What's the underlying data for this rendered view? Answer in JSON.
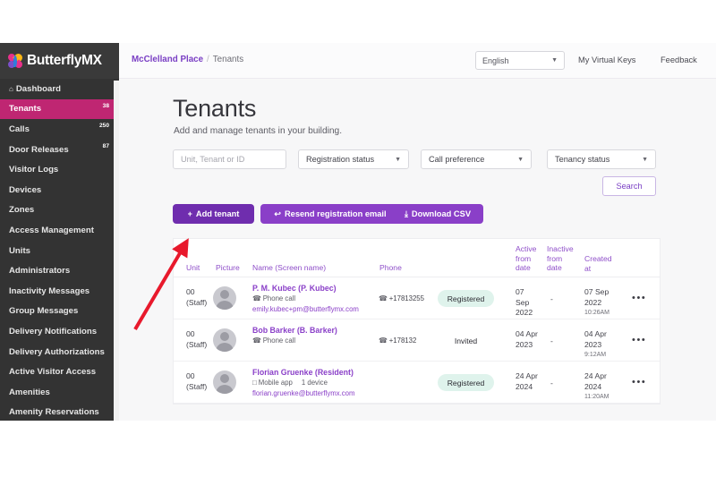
{
  "sidebar": {
    "logo_text": "ButterflyMX",
    "items": [
      {
        "label": "Dashboard",
        "badge": "",
        "active": false,
        "icon": "home-icon"
      },
      {
        "label": "Tenants",
        "badge": "38",
        "active": true,
        "icon": ""
      },
      {
        "label": "Calls",
        "badge": "250",
        "active": false,
        "icon": ""
      },
      {
        "label": "Door Releases",
        "badge": "87",
        "active": false,
        "icon": ""
      },
      {
        "label": "Visitor Logs",
        "badge": "",
        "active": false,
        "icon": ""
      },
      {
        "label": "Devices",
        "badge": "",
        "active": false,
        "icon": ""
      },
      {
        "label": "Zones",
        "badge": "",
        "active": false,
        "icon": ""
      },
      {
        "label": "Access Management",
        "badge": "",
        "active": false,
        "icon": ""
      },
      {
        "label": "Units",
        "badge": "",
        "active": false,
        "icon": ""
      },
      {
        "label": "Administrators",
        "badge": "",
        "active": false,
        "icon": ""
      },
      {
        "label": "Inactivity Messages",
        "badge": "",
        "active": false,
        "icon": ""
      },
      {
        "label": "Group Messages",
        "badge": "",
        "active": false,
        "icon": ""
      },
      {
        "label": "Delivery Notifications",
        "badge": "",
        "active": false,
        "icon": ""
      },
      {
        "label": "Delivery Authorizations",
        "badge": "",
        "active": false,
        "icon": ""
      },
      {
        "label": "Active Visitor Access",
        "badge": "",
        "active": false,
        "icon": ""
      },
      {
        "label": "Amenities",
        "badge": "",
        "active": false,
        "icon": ""
      },
      {
        "label": "Amenity Reservations",
        "badge": "",
        "active": false,
        "icon": ""
      }
    ]
  },
  "topbar": {
    "breadcrumb_building": "McClelland Place",
    "breadcrumb_separator": "/",
    "breadcrumb_current": "Tenants",
    "language_value": "English",
    "virtual_keys_label": "My Virtual Keys",
    "feedback_label": "Feedback"
  },
  "page": {
    "title": "Tenants",
    "subtitle": "Add and manage tenants in your building."
  },
  "filters": {
    "search_placeholder": "Unit, Tenant or ID",
    "registration_status": "Registration status",
    "call_preference": "Call preference",
    "tenancy_status": "Tenancy status",
    "search_button": "Search"
  },
  "actions": {
    "add_tenant": "Add tenant",
    "add_tenant_icon": "+",
    "resend_email": "Resend registration email",
    "resend_icon": "↩",
    "download_csv": "Download CSV",
    "download_icon": "⤓"
  },
  "table": {
    "headers": {
      "unit": "Unit",
      "picture": "Picture",
      "name": "Name (Screen name)",
      "phone": "Phone",
      "active_from_date": "Active from date",
      "inactive_from_date": "Inactive from date",
      "created_at": "Created at"
    },
    "rows": [
      {
        "unit": "00",
        "unit_role": "(Staff)",
        "name": "P. M. Kubec (P. Kubec)",
        "method_icon": "☎",
        "method": "Phone call",
        "devices": "",
        "email": "emily.kubec+pm@butterflymx.com",
        "phone_icon": "☎",
        "phone": "+17813255",
        "status": "Registered",
        "status_kind": "registered",
        "active_from": "07 Sep 2022",
        "inactive_from": "-",
        "created_date": "07 Sep 2022",
        "created_time": "10:26AM",
        "menu": "•••"
      },
      {
        "unit": "00",
        "unit_role": "(Staff)",
        "name": "Bob Barker (B. Barker)",
        "method_icon": "☎",
        "method": "Phone call",
        "devices": "",
        "email": "",
        "phone_icon": "☎",
        "phone": "+178132",
        "status": "Invited",
        "status_kind": "invited",
        "active_from": "04 Apr 2023",
        "inactive_from": "-",
        "created_date": "04 Apr 2023",
        "created_time": "9:12AM",
        "menu": "•••"
      },
      {
        "unit": "00",
        "unit_role": "(Staff)",
        "name": "Florian Gruenke (Resident)",
        "method_icon": "□",
        "method": "Mobile app",
        "devices": "1 device",
        "email": "florian.gruenke@butterflymx.com",
        "phone_icon": "",
        "phone": "",
        "status": "Registered",
        "status_kind": "registered",
        "active_from": "24 Apr 2024",
        "inactive_from": "-",
        "created_date": "24 Apr 2024",
        "created_time": "11:20AM",
        "menu": "•••"
      }
    ]
  },
  "annotation": {
    "arrow_color": "#e8192c"
  }
}
